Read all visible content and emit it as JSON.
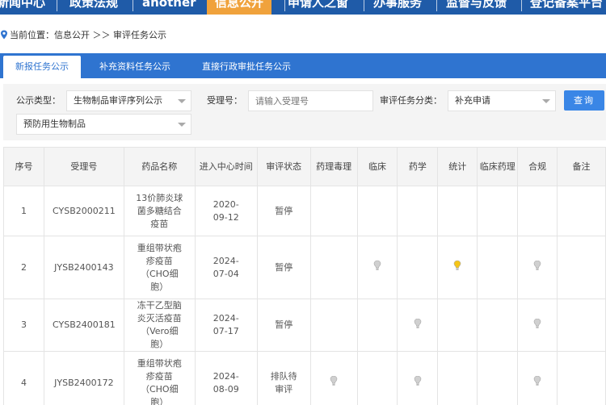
{
  "topnav": {
    "items": [
      {
        "label": "新闻中心",
        "active": false
      },
      {
        "label": "政策法规",
        "active": false
      },
      {
        "label": "another",
        "active": false
      },
      {
        "label": "信息公开",
        "active": true
      },
      {
        "label": "申请人之窗",
        "active": false
      },
      {
        "label": "办事服务",
        "active": false
      },
      {
        "label": "监督与反馈",
        "active": false
      },
      {
        "label": "登记备案平台",
        "active": false
      }
    ]
  },
  "breadcrumb": {
    "prefix": "当前位置：",
    "path": "信息公开 ＞＞ 审评任务公示"
  },
  "tabs": [
    {
      "label": "新报任务公示",
      "active": true
    },
    {
      "label": "补充资料任务公示",
      "active": false
    },
    {
      "label": "直接行政审批任务公示",
      "active": false
    }
  ],
  "filters": {
    "type_label": "公示类型：",
    "type_value": "生物制品审评序列公示",
    "subtype_value": "预防用生物制品",
    "accept_label": "受理号：",
    "accept_placeholder": "请输入受理号",
    "category_label": "审评任务分类：",
    "category_value": "补充申请",
    "query_label": "查询"
  },
  "table": {
    "headers": [
      "序号",
      "受理号",
      "药品名称",
      "进入中心时间",
      "审评状态",
      "药理毒理",
      "临床",
      "药学",
      "统计",
      "临床药理",
      "合规",
      "备注"
    ],
    "rows": [
      {
        "no": "1",
        "accept": "CYSB2000211",
        "name": "13价肺炎球菌多糖结合疫苗",
        "date": "2020-09-12",
        "status": "暂停",
        "marks": {
          "pharm_tox": null,
          "clinical": null,
          "pharmacy": null,
          "stats": null,
          "clin_pharm": null,
          "compliance": null
        }
      },
      {
        "no": "2",
        "accept": "JYSB2400143",
        "name": "重组带状疱疹疫苗（CHO细胞）",
        "date": "2024-07-04",
        "status": "暂停",
        "marks": {
          "pharm_tox": null,
          "clinical": "done",
          "pharmacy": null,
          "stats": "active",
          "clin_pharm": null,
          "compliance": "done"
        }
      },
      {
        "no": "3",
        "accept": "CYSB2400181",
        "name": "冻干乙型脑炎灭活疫苗（Vero细胞）",
        "date": "2024-07-17",
        "status": "暂停",
        "marks": {
          "pharm_tox": null,
          "clinical": null,
          "pharmacy": "done",
          "stats": null,
          "clin_pharm": null,
          "compliance": "done"
        }
      },
      {
        "no": "4",
        "accept": "JYSB2400172",
        "name": "重组带状疱疹疫苗（CHO细胞）",
        "date": "2024-08-09",
        "status": "排队待审评",
        "marks": {
          "pharm_tox": "done",
          "clinical": null,
          "pharmacy": "done",
          "stats": null,
          "clin_pharm": null,
          "compliance": "done"
        }
      }
    ]
  },
  "colors": {
    "nav_bg": "#1f5ba8",
    "nav_active": "#f0a23c",
    "tab_bg": "#2f74d0",
    "button": "#3a86e6",
    "bulb_done": "#d0d0d0",
    "bulb_active": "#f5c518"
  },
  "icons": {
    "breadcrumb": "location-pin-icon",
    "mark": "lightbulb-icon"
  }
}
